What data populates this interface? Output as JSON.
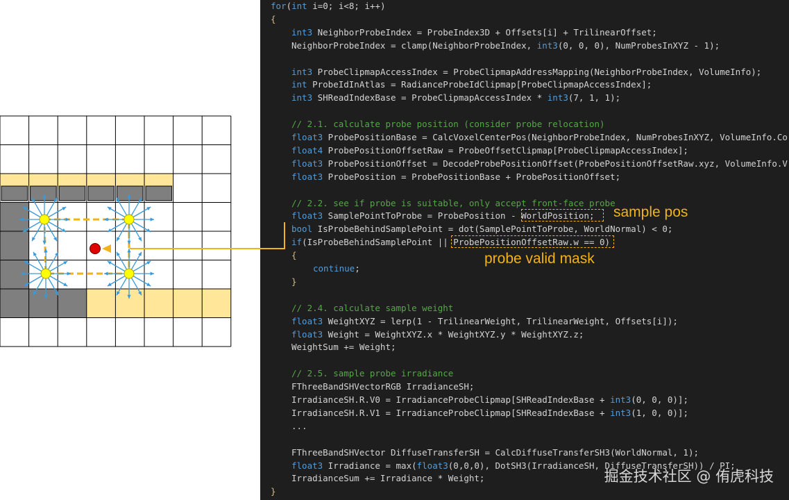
{
  "colors": {
    "code_bg": "#1e1e1e",
    "code_text": "#d4d4d4",
    "comment": "#57a64a",
    "keyword": "#569cd6",
    "brace": "#d7ba7d",
    "annotation": "#f2b318",
    "grid_line": "#000000",
    "wall_dark": "#7f7f7f",
    "wall_light": "#ffe699",
    "probe_fill": "#ffff00",
    "ray_color": "#3a9ad9",
    "sample_point": "#e00000"
  },
  "diagram": {
    "description_icons": [
      "probe-icon",
      "sample-point-icon",
      "ray-arrow-icon"
    ]
  },
  "code": {
    "lines": [
      {
        "indent": 0,
        "kind": "code",
        "text": "for(int i=0; i<8; i++)"
      },
      {
        "indent": 0,
        "kind": "brace",
        "text": "{"
      },
      {
        "indent": 1,
        "kind": "code",
        "text": "int3 NeighborProbeIndex = ProbeIndex3D + Offsets[i] + TrilinearOffset;"
      },
      {
        "indent": 1,
        "kind": "code",
        "text": "NeighborProbeIndex = clamp(NeighborProbeIndex, int3(0, 0, 0), NumProbesInXYZ - 1);"
      },
      {
        "indent": 1,
        "kind": "blank",
        "text": ""
      },
      {
        "indent": 1,
        "kind": "code",
        "text": "int3 ProbeClipmapAccessIndex = ProbeClipmapAddressMapping(NeighborProbeIndex, VolumeInfo);"
      },
      {
        "indent": 1,
        "kind": "code",
        "text": "int ProbeIdInAtlas = RadianceProbeIdClipmap[ProbeClipmapAccessIndex];"
      },
      {
        "indent": 1,
        "kind": "code",
        "text": "int3 SHReadIndexBase = ProbeClipmapAccessIndex * int3(7, 1, 1);"
      },
      {
        "indent": 1,
        "kind": "blank",
        "text": ""
      },
      {
        "indent": 1,
        "kind": "comment",
        "text": "// 2.1. calculate probe position (consider probe relocation)"
      },
      {
        "indent": 1,
        "kind": "code",
        "text": "float3 ProbePositionBase = CalcVoxelCenterPos(NeighborProbeIndex, NumProbesInXYZ, VolumeInfo.Co"
      },
      {
        "indent": 1,
        "kind": "code",
        "text": "float4 ProbePositionOffsetRaw = ProbeOffsetClipmap[ProbeClipmapAccessIndex];"
      },
      {
        "indent": 1,
        "kind": "code",
        "text": "float3 ProbePositionOffset = DecodeProbePositionOffset(ProbePositionOffsetRaw.xyz, VolumeInfo.V"
      },
      {
        "indent": 1,
        "kind": "code",
        "text": "float3 ProbePosition = ProbePositionBase + ProbePositionOffset;"
      },
      {
        "indent": 1,
        "kind": "blank",
        "text": ""
      },
      {
        "indent": 1,
        "kind": "comment",
        "text": "// 2.2. see if probe is suitable, only accept front-face probe"
      },
      {
        "indent": 1,
        "kind": "code",
        "text": "float3 SamplePointToProbe = ProbePosition - WorldPosition;"
      },
      {
        "indent": 1,
        "kind": "code",
        "text": "bool IsProbeBehindSamplePoint = dot(SamplePointToProbe, WorldNormal) < 0;"
      },
      {
        "indent": 1,
        "kind": "code",
        "text": "if(IsProbeBehindSamplePoint || ProbePositionOffsetRaw.w == 0)"
      },
      {
        "indent": 1,
        "kind": "brace",
        "text": "{"
      },
      {
        "indent": 2,
        "kind": "code",
        "text": "continue;"
      },
      {
        "indent": 1,
        "kind": "brace",
        "text": "}"
      },
      {
        "indent": 1,
        "kind": "blank",
        "text": ""
      },
      {
        "indent": 1,
        "kind": "comment",
        "text": "// 2.4. calculate sample weight"
      },
      {
        "indent": 1,
        "kind": "code",
        "text": "float3 WeightXYZ = lerp(1 - TrilinearWeight, TrilinearWeight, Offsets[i]);"
      },
      {
        "indent": 1,
        "kind": "code",
        "text": "float3 Weight = WeightXYZ.x * WeightXYZ.y * WeightXYZ.z;"
      },
      {
        "indent": 1,
        "kind": "code",
        "text": "WeightSum += Weight;"
      },
      {
        "indent": 1,
        "kind": "blank",
        "text": ""
      },
      {
        "indent": 1,
        "kind": "comment",
        "text": "// 2.5. sample probe irradiance"
      },
      {
        "indent": 1,
        "kind": "code",
        "text": "FThreeBandSHVectorRGB IrradianceSH;"
      },
      {
        "indent": 1,
        "kind": "code",
        "text": "IrradianceSH.R.V0 = IrradianceProbeClipmap[SHReadIndexBase + int3(0, 0, 0)];"
      },
      {
        "indent": 1,
        "kind": "code",
        "text": "IrradianceSH.R.V1 = IrradianceProbeClipmap[SHReadIndexBase + int3(1, 0, 0)];"
      },
      {
        "indent": 1,
        "kind": "code",
        "text": "..."
      },
      {
        "indent": 1,
        "kind": "blank",
        "text": ""
      },
      {
        "indent": 1,
        "kind": "code",
        "text": "FThreeBandSHVector DiffuseTransferSH = CalcDiffuseTransferSH3(WorldNormal, 1);"
      },
      {
        "indent": 1,
        "kind": "code",
        "text": "float3 Irradiance = max(float3(0,0,0), DotSH3(IrradianceSH, DiffuseTransferSH)) / PI;"
      },
      {
        "indent": 1,
        "kind": "code",
        "text": "IrradianceSum += Irradiance * Weight;"
      },
      {
        "indent": 0,
        "kind": "brace",
        "text": "}"
      }
    ]
  },
  "annotations": {
    "sample_pos": "sample pos",
    "probe_valid_mask": "probe valid mask"
  },
  "watermark": "掘金技术社区 @ 侑虎科技"
}
